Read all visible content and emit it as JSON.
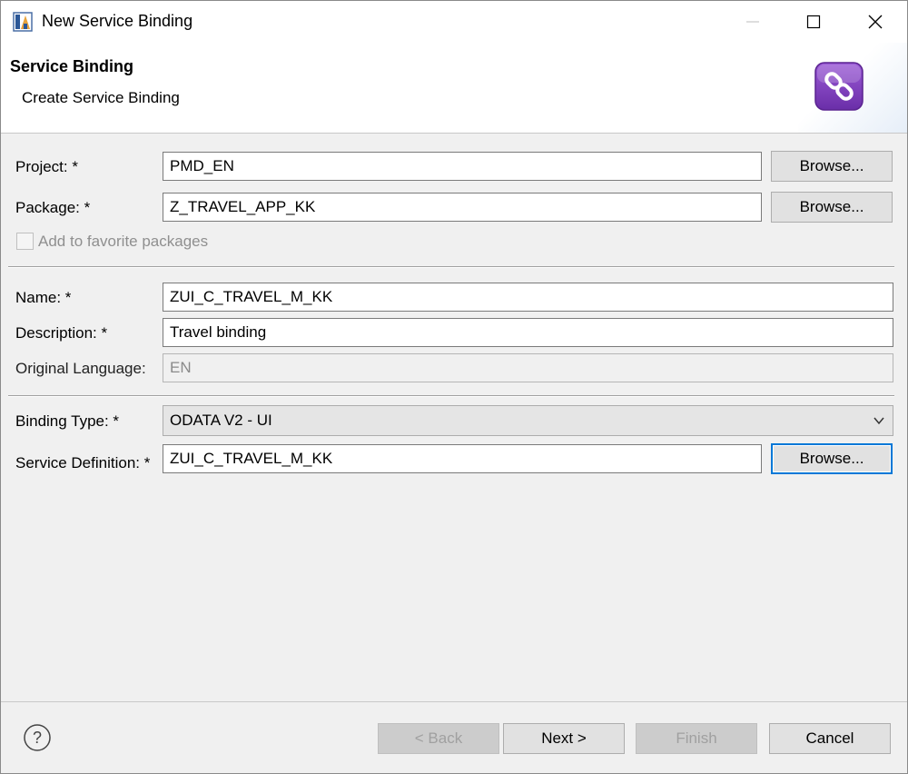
{
  "window": {
    "title": "New Service Binding",
    "icon": "eclipse-app-icon"
  },
  "banner": {
    "title": "Service Binding",
    "subtitle": "Create Service Binding",
    "icon": "service-binding-link-icon"
  },
  "form": {
    "project": {
      "label": "Project: *",
      "value": "PMD_EN",
      "browse": "Browse..."
    },
    "package": {
      "label": "Package: *",
      "value": "Z_TRAVEL_APP_KK",
      "browse": "Browse..."
    },
    "favorite": {
      "label": "Add to favorite packages",
      "checked": false
    },
    "name": {
      "label": "Name: *",
      "value": "ZUI_C_TRAVEL_M_KK"
    },
    "description": {
      "label": "Description: *",
      "value": "Travel binding"
    },
    "original_language": {
      "label": "Original Language:",
      "value": "EN"
    },
    "binding_type": {
      "label": "Binding Type: *",
      "value": "ODATA V2 - UI"
    },
    "service_definition": {
      "label": "Service Definition: *",
      "value": "ZUI_C_TRAVEL_M_KK",
      "browse": "Browse..."
    }
  },
  "footer": {
    "back": "< Back",
    "next": "Next >",
    "finish": "Finish",
    "cancel": "Cancel"
  },
  "colors": {
    "icon_purple": "#7b3fb5",
    "focus_blue": "#0078d7"
  }
}
